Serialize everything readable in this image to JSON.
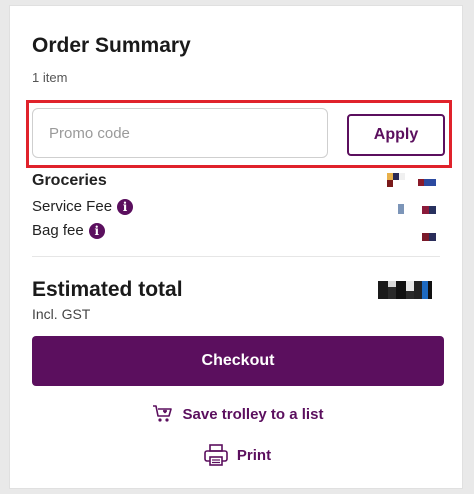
{
  "summary": {
    "title": "Order Summary",
    "item_count": "1 item"
  },
  "promo": {
    "placeholder": "Promo code",
    "value": "",
    "apply_label": "Apply"
  },
  "lines": {
    "groceries": "Groceries",
    "service_fee": "Service Fee",
    "bag_fee": "Bag fee"
  },
  "total": {
    "label": "Estimated total",
    "sub": "Incl. GST"
  },
  "actions": {
    "checkout": "Checkout",
    "save_trolley": "Save trolley to a list",
    "print": "Print"
  },
  "icons": {
    "info": "info-icon",
    "trolley_heart": "trolley-heart-icon",
    "printer": "printer-icon"
  },
  "colors": {
    "brand": "#5b0f5e",
    "highlight": "#e0222b"
  }
}
